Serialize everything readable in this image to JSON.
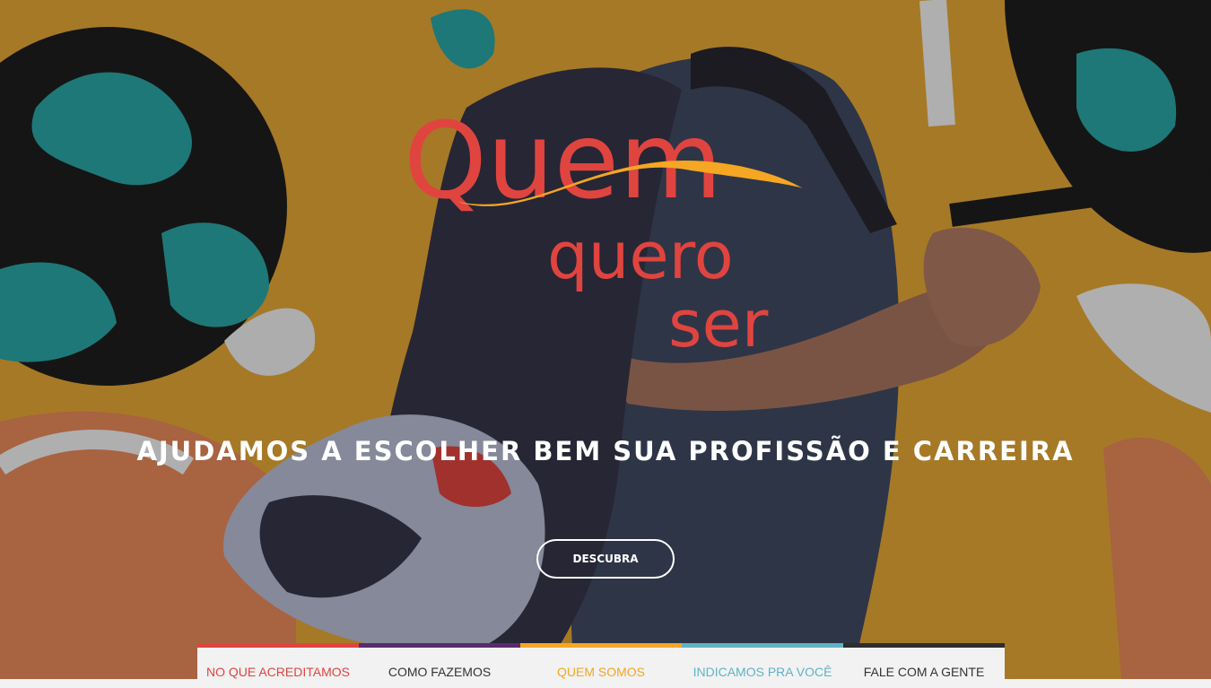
{
  "brand": {
    "logo_line1": "Quem",
    "logo_line2": "quero",
    "logo_line3": "ser",
    "logo_color": "#e0443f",
    "swoosh_color": "#f5a623"
  },
  "hero": {
    "headline": "AJUDAMOS A ESCOLHER BEM SUA PROFISSÃO E CARREIRA",
    "cta_label": "DESCUBRA"
  },
  "nav": {
    "items": [
      {
        "label": "NO QUE ACREDITAMOS",
        "color": "#e0443f",
        "bar_color": "#e0443f"
      },
      {
        "label": "COMO FAZEMOS",
        "color": "#333333",
        "bar_color": "#5a2a6e"
      },
      {
        "label": "QUEM SOMOS",
        "color": "#f5a623",
        "bar_color": "#f5a623"
      },
      {
        "label": "INDICAMOS PRA VOCÊ",
        "color": "#5fb3c4",
        "bar_color": "#5fb3c4"
      },
      {
        "label": "FALE COM A GENTE",
        "color": "#333333",
        "bar_color": "#2d2d2d"
      }
    ]
  }
}
